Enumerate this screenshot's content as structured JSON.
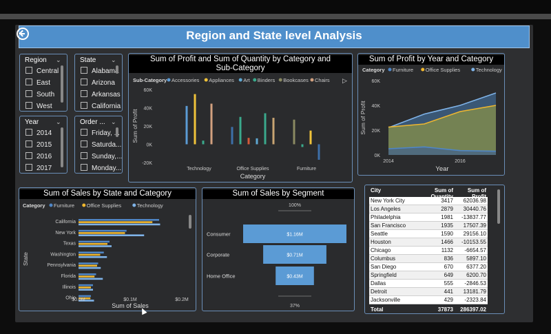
{
  "title": "Region and State level Analysis",
  "slicers": {
    "region": {
      "header": "Region",
      "items": [
        "Central",
        "East",
        "South",
        "West"
      ]
    },
    "state": {
      "header": "State",
      "items": [
        "Alabama",
        "Arizona",
        "Arkansas",
        "California"
      ]
    },
    "year": {
      "header": "Year",
      "items": [
        "2014",
        "2015",
        "2016",
        "2017"
      ]
    },
    "order": {
      "header": "Order ...",
      "items": [
        "Friday, ...",
        "Saturda...",
        "Sunday,...",
        "Monday..."
      ]
    }
  },
  "chart_data": [
    {
      "id": "profit_qty",
      "type": "bar",
      "title": "Sum of Profit and Sum of Quantity by Category and Sub-Category",
      "legend_title": "Sub-Category",
      "legend": [
        "Accessories",
        "Appliances",
        "Art",
        "Binders",
        "Bookcases",
        "Chairs"
      ],
      "colors": [
        "#5b9bd5",
        "#f0c33a",
        "#5fa8d3",
        "#3aa98c",
        "#8a8a62",
        "#d2a07f",
        "#c8a472",
        "#d45a3a",
        "#e1c55a",
        "#3d6fa8",
        "#6a9fd0",
        "#b3845e",
        "#3f8fb0"
      ],
      "xlabel": "Category",
      "ylabel": "Sum of Profit",
      "ylim": [
        -20000,
        60000
      ],
      "yticks": [
        "-20K",
        "0K",
        "20K",
        "40K",
        "60K"
      ],
      "categories": [
        "Technology",
        "Office Supplies",
        "Furniture"
      ],
      "bars": [
        {
          "category": "Technology",
          "color": "#5b9bd5",
          "value": 42000
        },
        {
          "category": "Technology",
          "color": "#f0c33a",
          "value": 55000
        },
        {
          "category": "Technology",
          "color": "#3aa98c",
          "value": 4000
        },
        {
          "category": "Technology",
          "color": "#d2a07f",
          "value": 44500
        },
        {
          "category": "Office Supplies",
          "color": "#3d6fa8",
          "value": 19000
        },
        {
          "category": "Office Supplies",
          "color": "#3aa98c",
          "value": 30000
        },
        {
          "category": "Office Supplies",
          "color": "#d45a3a",
          "value": 7000
        },
        {
          "category": "Office Supplies",
          "color": "#5fa8d3",
          "value": 6500
        },
        {
          "category": "Office Supplies",
          "color": "#3aa98c",
          "value": 34000
        },
        {
          "category": "Office Supplies",
          "color": "#c8a472",
          "value": 29000
        },
        {
          "category": "Furniture",
          "color": "#8a8a62",
          "value": 27000
        },
        {
          "category": "Furniture",
          "color": "#3aa98c",
          "value": -3000
        },
        {
          "category": "Furniture",
          "color": "#f0c33a",
          "value": 15000
        },
        {
          "category": "Furniture",
          "color": "#3d6fa8",
          "value": -17000
        }
      ]
    },
    {
      "id": "profit_year",
      "type": "area",
      "title": "Sum of Profit by Year and Category",
      "legend_title": "Category",
      "series": [
        {
          "name": "Furniture",
          "color": "#4f86c6",
          "values": [
            5000,
            6500,
            3500,
            3000
          ]
        },
        {
          "name": "Office Supplies",
          "color": "#f0b72f",
          "values": [
            22500,
            25000,
            35000,
            40000
          ]
        },
        {
          "name": "Technology",
          "color": "#7fb3e8",
          "values": [
            22000,
            33000,
            40000,
            50000
          ]
        }
      ],
      "x": [
        2014,
        2015,
        2016,
        2017
      ],
      "xticks": [
        "2014",
        "2016"
      ],
      "xlabel": "Year",
      "ylabel": "Sum of Profit",
      "ylim": [
        0,
        60000
      ],
      "yticks": [
        "0K",
        "20K",
        "40K",
        "60K"
      ]
    },
    {
      "id": "sales_state",
      "type": "bar",
      "orientation": "horizontal",
      "title": "Sum of Sales by State and Category",
      "legend_title": "Category",
      "legend": [
        "Furniture",
        "Office Supplies",
        "Technology"
      ],
      "colors": [
        "#4f86c6",
        "#f0b72f",
        "#7fb3e8"
      ],
      "categories": [
        "California",
        "New York",
        "Texas",
        "Washington",
        "Pennsylvania",
        "Florida",
        "Illinois",
        "Ohio"
      ],
      "series": [
        {
          "name": "Furniture",
          "values": [
            0.156,
            0.093,
            0.06,
            0.049,
            0.038,
            0.034,
            0.028,
            0.024
          ]
        },
        {
          "name": "Office Supplies",
          "values": [
            0.143,
            0.09,
            0.056,
            0.042,
            0.036,
            0.031,
            0.024,
            0.023
          ]
        },
        {
          "name": "Technology",
          "values": [
            0.158,
            0.127,
            0.064,
            0.055,
            0.043,
            0.047,
            0.028,
            0.03
          ]
        }
      ],
      "xlabel": "Sum of Sales",
      "ylabel": "State",
      "xlim": [
        0,
        0.2
      ],
      "xticks": [
        "$0.0M",
        "$0.1M",
        "$0.2M"
      ]
    },
    {
      "id": "sales_segment",
      "type": "bar",
      "subtype": "funnel",
      "title": "Sum of Sales by Segment",
      "categories": [
        "Consumer",
        "Corporate",
        "Home Office"
      ],
      "values": [
        1.16,
        0.71,
        0.43
      ],
      "labels": [
        "$1.16M",
        "$0.71M",
        "$0.43M"
      ],
      "top_label": "100%",
      "bottom_label": "37%",
      "color": "#5b9bd5"
    },
    {
      "id": "city_table",
      "type": "table",
      "columns": [
        "City",
        "Sum of Quantity",
        "Sum of Profit"
      ],
      "rows": [
        [
          "New York City",
          "3417",
          "62036.98"
        ],
        [
          "Los Angeles",
          "2879",
          "30440.76"
        ],
        [
          "Philadelphia",
          "1981",
          "-13837.77"
        ],
        [
          "San Francisco",
          "1935",
          "17507.39"
        ],
        [
          "Seattle",
          "1590",
          "29156.10"
        ],
        [
          "Houston",
          "1466",
          "-10153.55"
        ],
        [
          "Chicago",
          "1132",
          "-6654.57"
        ],
        [
          "Columbus",
          "836",
          "5897.10"
        ],
        [
          "San Diego",
          "670",
          "6377.20"
        ],
        [
          "Springfield",
          "649",
          "6200.70"
        ],
        [
          "Dallas",
          "555",
          "-2846.53"
        ],
        [
          "Detroit",
          "441",
          "13181.79"
        ],
        [
          "Jacksonville",
          "429",
          "-2323.84"
        ]
      ],
      "total": [
        "Total",
        "37873",
        "286397.02"
      ]
    }
  ]
}
